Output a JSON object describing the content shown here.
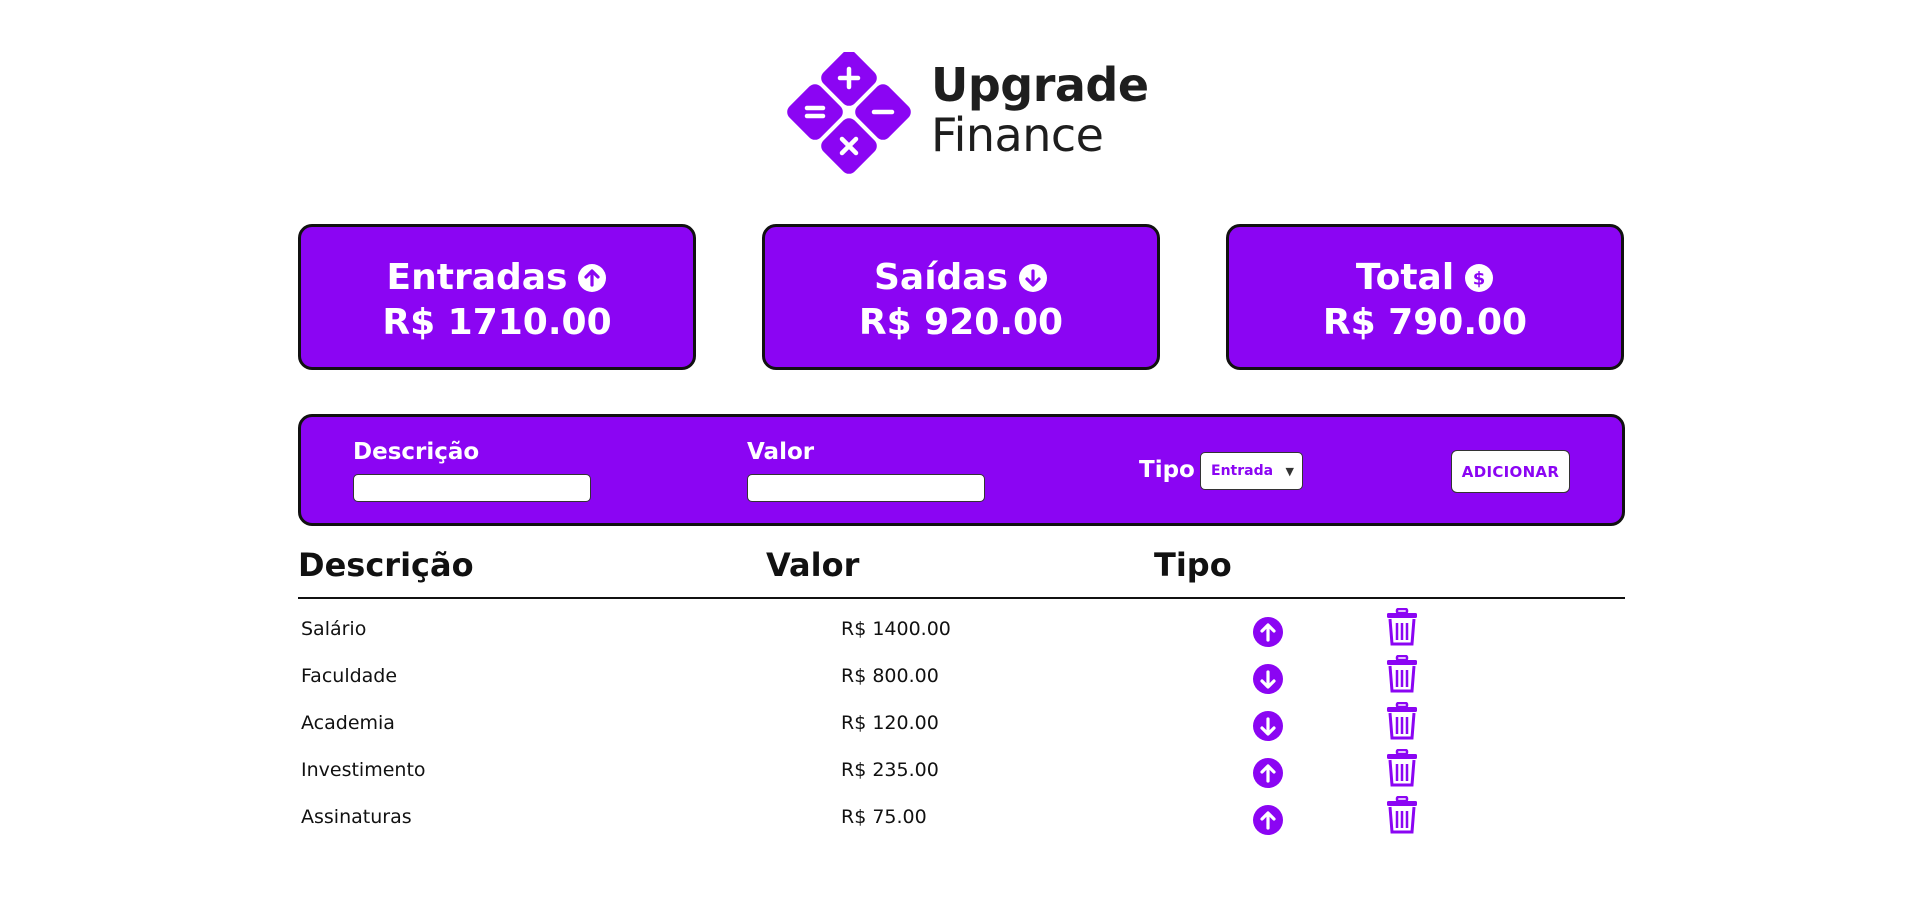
{
  "brand": {
    "name_line1": "Upgrade",
    "name_line2": "Finance",
    "accent_color": "#8b05f3"
  },
  "summary": [
    {
      "title": "Entradas",
      "icon": "arrow-up-circle-icon",
      "amount": "R$ 1710.00"
    },
    {
      "title": "Saídas",
      "icon": "arrow-down-circle-icon",
      "amount": "R$ 920.00"
    },
    {
      "title": "Total",
      "icon": "dollar-circle-icon",
      "amount": "R$ 790.00"
    }
  ],
  "form": {
    "description_label": "Descrição",
    "description_value": "",
    "value_label": "Valor",
    "value_value": "",
    "type_label": "Tipo",
    "type_selected": "Entrada",
    "add_button": "ADICIONAR"
  },
  "table": {
    "headers": [
      "Descrição",
      "Valor",
      "Tipo"
    ],
    "rows": [
      {
        "description": "Salário",
        "value": "R$ 1400.00",
        "type_icon": "arrow-up-circle-icon"
      },
      {
        "description": "Faculdade",
        "value": "R$ 800.00",
        "type_icon": "arrow-down-circle-icon"
      },
      {
        "description": "Academia",
        "value": "R$ 120.00",
        "type_icon": "arrow-down-circle-icon"
      },
      {
        "description": "Investimento",
        "value": "R$ 235.00",
        "type_icon": "arrow-up-circle-icon"
      },
      {
        "description": "Assinaturas",
        "value": "R$ 75.00",
        "type_icon": "arrow-up-circle-icon"
      }
    ]
  }
}
